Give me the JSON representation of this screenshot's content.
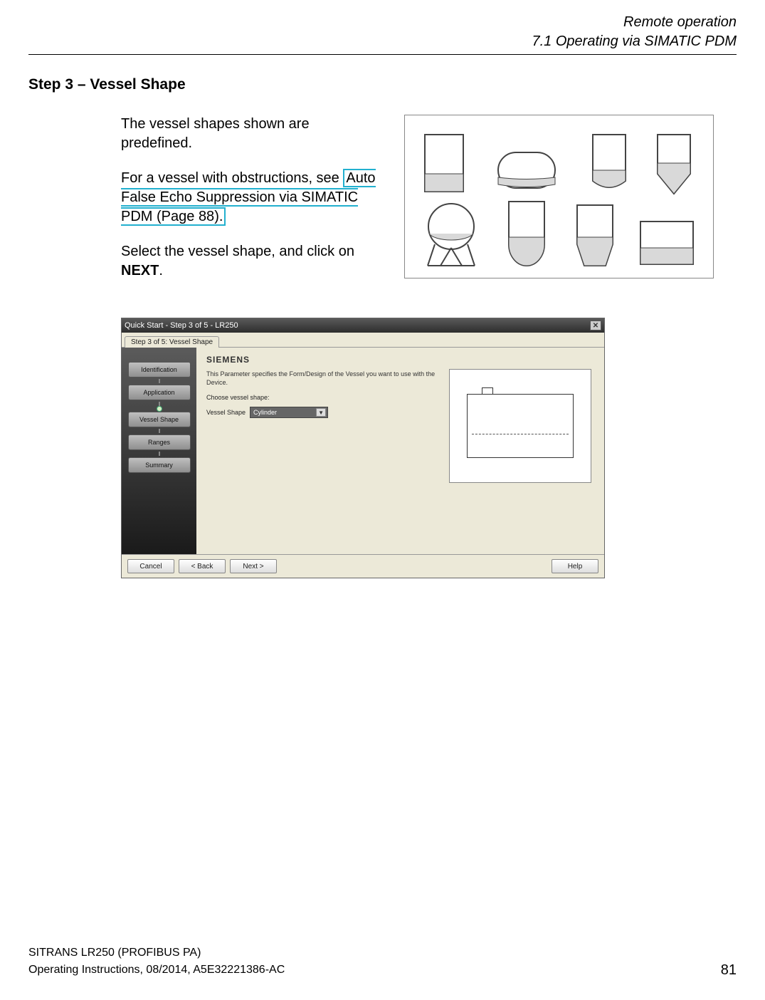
{
  "header": {
    "chapter": "Remote operation",
    "section": "7.1 Operating via SIMATIC PDM"
  },
  "step_title": "Step 3 – Vessel Shape",
  "body": {
    "p1": "The vessel shapes shown are predefined.",
    "p2a": "For a vessel with obstructions, see ",
    "p2b_link": "Auto False Echo Suppression via SIMATIC PDM",
    "p2c": " (Page ",
    "p2d_page": "88",
    "p2e": ").",
    "p3a": "Select the vessel shape, and click on ",
    "p3b_bold": "NEXT",
    "p3c": "."
  },
  "dialog": {
    "title": "Quick Start - Step 3 of 5 - LR250",
    "tab": "Step 3 of 5: Vessel Shape",
    "sidebar": [
      "Identification",
      "Application",
      "Vessel Shape",
      "Ranges",
      "Summary"
    ],
    "brand": "SIEMENS",
    "desc": "This Parameter specifies the Form/Design of the Vessel you want to use with the Device.",
    "choose": "Choose vessel shape:",
    "field_label": "Vessel Shape",
    "field_value": "Cylinder",
    "buttons": {
      "cancel": "Cancel",
      "back": "< Back",
      "next": "Next >",
      "help": "Help"
    }
  },
  "footer": {
    "line1": "SITRANS LR250 (PROFIBUS PA)",
    "line2": "Operating Instructions, 08/2014, A5E32221386-AC",
    "page": "81"
  }
}
